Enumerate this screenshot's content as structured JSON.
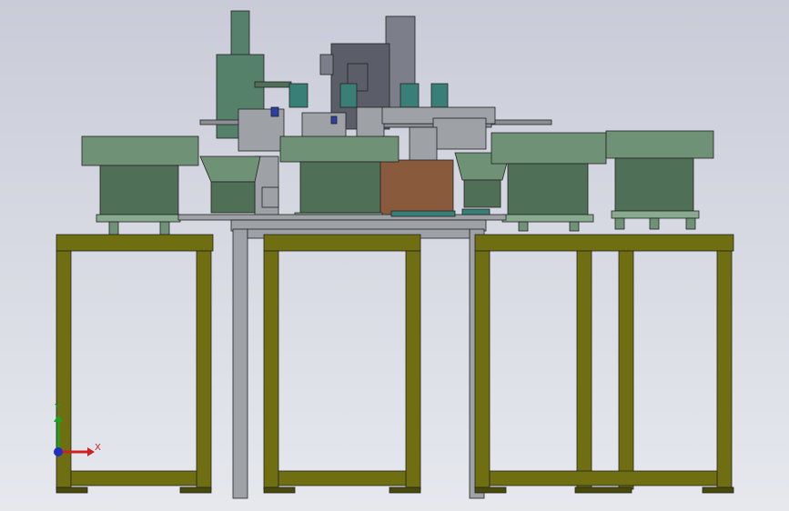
{
  "viewport": {
    "background_top": "#c9ccd8",
    "background_bottom": "#e6e8ee"
  },
  "colors": {
    "frame": "#6f6f12",
    "frame_dark": "#4a4a08",
    "frame_light": "#8c8c28",
    "feeder": "#6f9276",
    "feeder_dark": "#4f6f56",
    "feeder_light": "#88aa8e",
    "motor": "#7c7f8a",
    "motor_dark": "#5b5e68",
    "column": "#55806a",
    "pipe": "#8c8f94",
    "plate": "#9ea2a6",
    "brown": "#8a5a3c",
    "teal": "#3a7f77",
    "blue": "#2b3fa6",
    "axis_x": "#d12020",
    "axis_y": "#20a020",
    "axis_z": "#2030c0"
  },
  "triad": {
    "x_label": "X",
    "y_label": "Y",
    "icons": [
      "x-axis-arrow-icon",
      "y-axis-arrow-icon",
      "z-axis-dot-icon"
    ]
  }
}
